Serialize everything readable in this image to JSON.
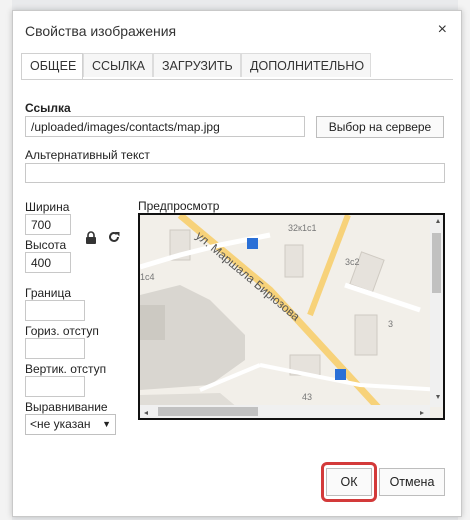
{
  "dialog": {
    "title": "Свойства изображения",
    "close_symbol": "×"
  },
  "tabs": [
    {
      "label": "ОБЩЕЕ"
    },
    {
      "label": "ССЫЛКА"
    },
    {
      "label": "ЗАГРУЗИТЬ"
    },
    {
      "label": "ДОПОЛНИТЕЛЬНО"
    }
  ],
  "form": {
    "link_label": "Ссылка",
    "link_value": "/uploaded/images/contacts/map.jpg",
    "browse_button": "Выбор на сервере",
    "alt_label": "Альтернативный текст",
    "alt_value": "",
    "width_label": "Ширина",
    "width_value": "700",
    "height_label": "Высота",
    "height_value": "400",
    "border_label": "Граница",
    "border_value": "",
    "hspace_label": "Гориз. отступ",
    "hspace_value": "",
    "vspace_label": "Вертик. отступ",
    "vspace_value": "",
    "align_label": "Выравнивание",
    "align_value": "<не указан",
    "preview_label": "Предпросмотр"
  },
  "map": {
    "street_label": "ул. Маршала Бирюзова",
    "building_labels": [
      "32к1с1",
      "3с2",
      "1с4",
      "3",
      "43"
    ]
  },
  "footer": {
    "ok_label": "ОК",
    "cancel_label": "Отмена"
  },
  "colors": {
    "highlight": "#d33a3a",
    "road": "#f7d27a",
    "block": "#d9d6d0"
  }
}
